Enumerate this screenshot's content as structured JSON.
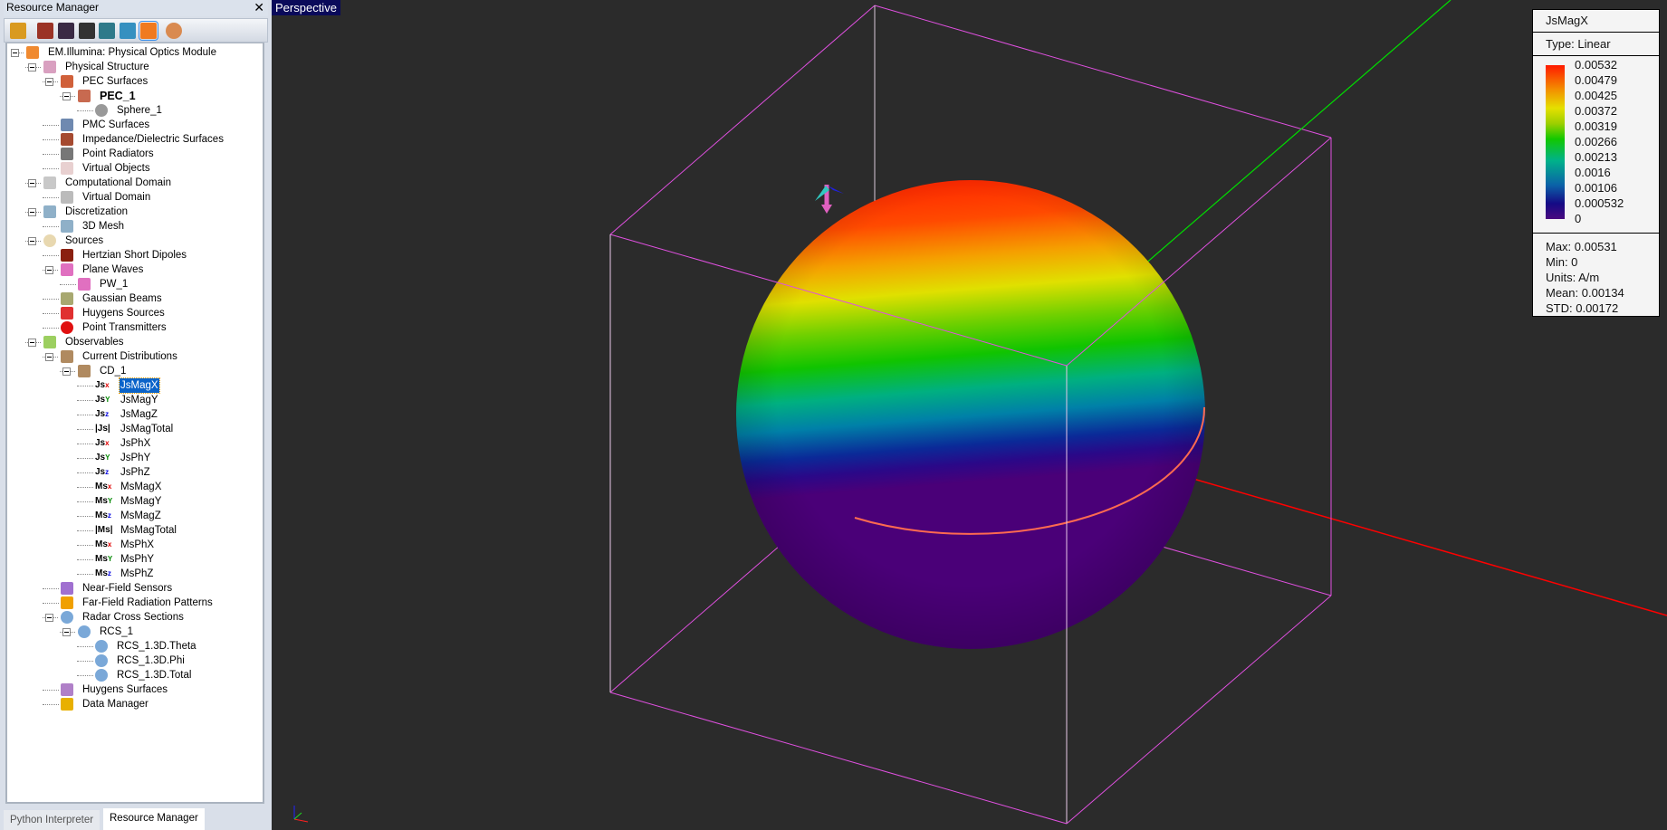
{
  "panel": {
    "title": "Resource Manager",
    "close": "✕",
    "toolbar": [
      {
        "icon": "project-icon",
        "color": "#d99a20"
      },
      {
        "icon": "pec-material-icon",
        "color": "#9b3326"
      },
      {
        "icon": "waves-icon",
        "color": "#3a2a44"
      },
      {
        "icon": "molecule-icon",
        "color": "#333"
      },
      {
        "icon": "antenna-icon",
        "color": "#2f7a8a"
      },
      {
        "icon": "scatter-icon",
        "color": "#3590c0"
      },
      {
        "icon": "physical-optics-icon",
        "color": "#f07a20",
        "selected": true
      },
      {
        "icon": "globe-icon",
        "color": "#d98a50"
      }
    ],
    "tree": [
      {
        "label": "EM.Illumina: Physical Optics Module",
        "level": 0,
        "exp": true,
        "icon": "module-icon",
        "color": "#f08a30"
      },
      {
        "label": "Physical Structure",
        "level": 1,
        "exp": true,
        "icon": "structure-icon",
        "color": "#d9a0c0"
      },
      {
        "label": "PEC Surfaces",
        "level": 2,
        "exp": true,
        "icon": "pec-surfaces-icon",
        "color": "#d0603a"
      },
      {
        "label": "PEC_1",
        "level": 3,
        "exp": true,
        "icon": "pec-group-icon",
        "color": "#c86a50",
        "bold": true
      },
      {
        "label": "Sphere_1",
        "level": 4,
        "icon": "sphere-icon",
        "color": "#999",
        "round": true
      },
      {
        "label": "PMC Surfaces",
        "level": 2,
        "icon": "pmc-surfaces-icon",
        "color": "#6f89b0"
      },
      {
        "label": "Impedance/Dielectric Surfaces",
        "level": 2,
        "icon": "impedance-surfaces-icon",
        "color": "#a54a30"
      },
      {
        "label": "Point Radiators",
        "level": 2,
        "icon": "point-radiator-icon",
        "color": "#777"
      },
      {
        "label": "Virtual Objects",
        "level": 2,
        "icon": "virtual-objects-icon",
        "color": "#e8d0d0"
      },
      {
        "label": "Computational Domain",
        "level": 1,
        "exp": true,
        "icon": "domain-icon",
        "color": "#c8c8c8"
      },
      {
        "label": "Virtual Domain",
        "level": 2,
        "icon": "virtual-domain-icon",
        "color": "#bbb"
      },
      {
        "label": "Discretization",
        "level": 1,
        "exp": true,
        "icon": "grid-icon",
        "color": "#8fb0c8"
      },
      {
        "label": "3D Mesh",
        "level": 2,
        "icon": "mesh-icon",
        "color": "#8fb0c8"
      },
      {
        "label": "Sources",
        "level": 1,
        "exp": true,
        "icon": "sources-icon",
        "color": "#e8d8b0",
        "round": true
      },
      {
        "label": "Hertzian Short Dipoles",
        "level": 2,
        "icon": "dipole-icon",
        "color": "#8a2010"
      },
      {
        "label": "Plane Waves",
        "level": 2,
        "exp": true,
        "icon": "plane-wave-icon",
        "color": "#e070c0"
      },
      {
        "label": "PW_1",
        "level": 3,
        "icon": "plane-wave-icon",
        "color": "#e070c0"
      },
      {
        "label": "Gaussian Beams",
        "level": 2,
        "icon": "gaussian-beam-icon",
        "color": "#a8a870"
      },
      {
        "label": "Huygens Sources",
        "level": 2,
        "icon": "huygens-source-icon",
        "color": "#e03030"
      },
      {
        "label": "Point Transmitters",
        "level": 2,
        "icon": "transmitter-icon",
        "color": "#e01010",
        "round": true
      },
      {
        "label": "Observables",
        "level": 1,
        "exp": true,
        "icon": "observables-icon",
        "color": "#9ccf60"
      },
      {
        "label": "Current Distributions",
        "level": 2,
        "exp": true,
        "icon": "current-distribution-icon",
        "color": "#b08a60"
      },
      {
        "label": "CD_1",
        "level": 3,
        "exp": true,
        "icon": "current-distribution-icon",
        "color": "#b08a60"
      },
      {
        "label": "JsMagX",
        "level": 4,
        "icon": "js-x-icon",
        "glyph": "Js",
        "sub": "x",
        "subcolor": "#e00000",
        "selected": true
      },
      {
        "label": "JsMagY",
        "level": 4,
        "icon": "js-y-icon",
        "glyph": "Js",
        "sub": "Y",
        "subcolor": "#008800"
      },
      {
        "label": "JsMagZ",
        "level": 4,
        "icon": "js-z-icon",
        "glyph": "Js",
        "sub": "z",
        "subcolor": "#0000e0"
      },
      {
        "label": "JsMagTotal",
        "level": 4,
        "icon": "js-total-icon",
        "glyph": "|Js|",
        "sub": "",
        "subcolor": "#000"
      },
      {
        "label": "JsPhX",
        "level": 4,
        "icon": "js-x-icon",
        "glyph": "Js",
        "sub": "x",
        "subcolor": "#e00000"
      },
      {
        "label": "JsPhY",
        "level": 4,
        "icon": "js-y-icon",
        "glyph": "Js",
        "sub": "Y",
        "subcolor": "#008800"
      },
      {
        "label": "JsPhZ",
        "level": 4,
        "icon": "js-z-icon",
        "glyph": "Js",
        "sub": "z",
        "subcolor": "#0000e0"
      },
      {
        "label": "MsMagX",
        "level": 4,
        "icon": "ms-x-icon",
        "glyph": "Ms",
        "sub": "x",
        "subcolor": "#e00000"
      },
      {
        "label": "MsMagY",
        "level": 4,
        "icon": "ms-y-icon",
        "glyph": "Ms",
        "sub": "Y",
        "subcolor": "#008800"
      },
      {
        "label": "MsMagZ",
        "level": 4,
        "icon": "ms-z-icon",
        "glyph": "Ms",
        "sub": "z",
        "subcolor": "#0000e0"
      },
      {
        "label": "MsMagTotal",
        "level": 4,
        "icon": "ms-total-icon",
        "glyph": "|Ms|",
        "sub": "",
        "subcolor": "#000"
      },
      {
        "label": "MsPhX",
        "level": 4,
        "icon": "ms-x-icon",
        "glyph": "Ms",
        "sub": "x",
        "subcolor": "#e00000"
      },
      {
        "label": "MsPhY",
        "level": 4,
        "icon": "ms-y-icon",
        "glyph": "Ms",
        "sub": "Y",
        "subcolor": "#008800"
      },
      {
        "label": "MsPhZ",
        "level": 4,
        "icon": "ms-z-icon",
        "glyph": "Ms",
        "sub": "z",
        "subcolor": "#0000e0"
      },
      {
        "label": "Near-Field Sensors",
        "level": 2,
        "icon": "near-field-sensor-icon",
        "color": "#a070d0"
      },
      {
        "label": "Far-Field Radiation Patterns",
        "level": 2,
        "icon": "far-field-pattern-icon",
        "color": "#f0a000"
      },
      {
        "label": "Radar Cross Sections",
        "level": 2,
        "exp": true,
        "icon": "rcs-icon",
        "color": "#7aa8d8",
        "round": true
      },
      {
        "label": "RCS_1",
        "level": 3,
        "exp": true,
        "icon": "rcs-icon",
        "color": "#7aa8d8",
        "round": true
      },
      {
        "label": "RCS_1.3D.Theta",
        "level": 4,
        "icon": "rcs-icon",
        "color": "#7aa8d8",
        "round": true
      },
      {
        "label": "RCS_1.3D.Phi",
        "level": 4,
        "icon": "rcs-icon",
        "color": "#7aa8d8",
        "round": true
      },
      {
        "label": "RCS_1.3D.Total",
        "level": 4,
        "icon": "rcs-icon",
        "color": "#7aa8d8",
        "round": true
      },
      {
        "label": "Huygens Surfaces",
        "level": 2,
        "icon": "huygens-surface-icon",
        "color": "#b080c8"
      },
      {
        "label": "Data Manager",
        "level": 2,
        "icon": "data-manager-icon",
        "color": "#e8b000"
      }
    ]
  },
  "tabs": [
    "Python Interpreter",
    "Resource Manager"
  ],
  "viewport": {
    "view_label": "Perspective"
  },
  "legend": {
    "title": "JsMagX",
    "type": "Type: Linear",
    "ticks": [
      "0.00532",
      "0.00479",
      "0.00425",
      "0.00372",
      "0.00319",
      "0.00266",
      "0.00213",
      "0.0016",
      "0.00106",
      "0.000532",
      "0"
    ],
    "stats": [
      "Max: 0.00531",
      "Min: 0",
      "Units: A/m",
      "Mean: 0.00134",
      "STD: 0.00172"
    ]
  },
  "colors": {
    "box": "#e050e0",
    "x_axis": "#ff0000",
    "y_axis": "#00dd00",
    "equator": "#ff6a50"
  }
}
